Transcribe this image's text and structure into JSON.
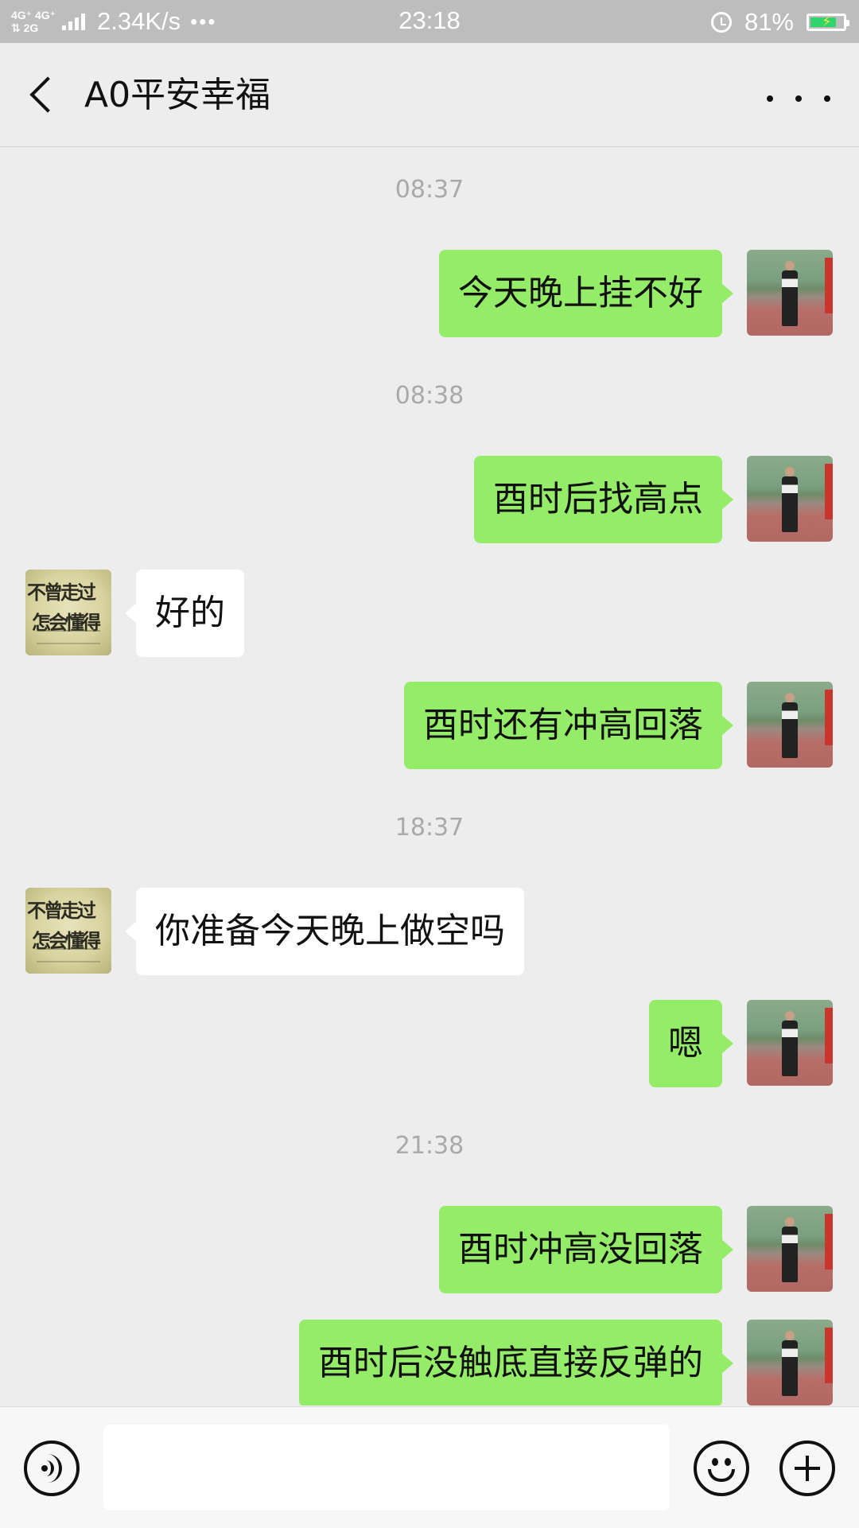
{
  "status_bar": {
    "network_top": "4G⁺ 4G⁺",
    "network_bottom": "⇅ 2G",
    "speed": "2.34K/s",
    "dots": "•••",
    "time": "23:18",
    "battery_percent": "81%",
    "battery_level": 0.81
  },
  "header": {
    "title": "A0平安幸福"
  },
  "avatar_them_text": [
    "不曾走过",
    "怎会懂得"
  ],
  "messages": [
    {
      "type": "timestamp",
      "text": "08:37"
    },
    {
      "type": "outgoing",
      "text": "今天晚上挂不好"
    },
    {
      "type": "timestamp",
      "text": "08:38"
    },
    {
      "type": "outgoing",
      "text": "酉时后找高点"
    },
    {
      "type": "incoming",
      "text": "好的"
    },
    {
      "type": "outgoing",
      "text": "酉时还有冲高回落"
    },
    {
      "type": "timestamp",
      "text": "18:37"
    },
    {
      "type": "incoming",
      "text": "你准备今天晚上做空吗"
    },
    {
      "type": "outgoing",
      "text": "嗯"
    },
    {
      "type": "timestamp",
      "text": "21:38"
    },
    {
      "type": "outgoing",
      "text": "酉时冲高没回落"
    },
    {
      "type": "outgoing",
      "text": "酉时后没触底直接反弹的"
    }
  ],
  "input": {
    "value": "",
    "placeholder": ""
  }
}
